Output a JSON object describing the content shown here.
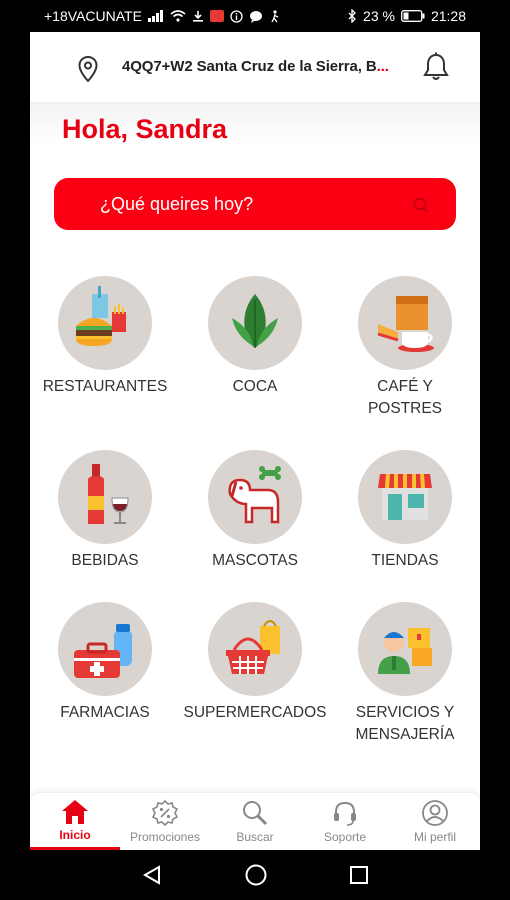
{
  "statusbar": {
    "carrier": "+18VACUNATE",
    "battery": "23 %",
    "time": "21:28"
  },
  "header": {
    "address": "4QQ7+W2 Santa Cruz de la Sierra, B",
    "address_ellipsis": "...",
    "pin_icon": "location-pin-icon",
    "bell_icon": "bell-icon"
  },
  "greeting": "Hola, Sandra",
  "search": {
    "placeholder": "¿Qué queires hoy?"
  },
  "colors": {
    "brand_red": "#e60012",
    "search_red": "#fb0012",
    "circle_bg": "#d9d4cf"
  },
  "categories": [
    {
      "label": "RESTAURANTES",
      "icon": "burger-fries-icon"
    },
    {
      "label": "COCA",
      "icon": "coca-leaves-icon"
    },
    {
      "label": "CAFÉ Y\nPOSTRES",
      "icon": "coffee-cake-icon"
    },
    {
      "label": "BEBIDAS",
      "icon": "bottle-wine-icon"
    },
    {
      "label": "MASCOTAS",
      "icon": "dog-bone-icon"
    },
    {
      "label": "TIENDAS",
      "icon": "storefront-icon"
    },
    {
      "label": "FARMACIAS",
      "icon": "first-aid-kit-icon"
    },
    {
      "label": "SUPERMERCADOS",
      "icon": "shopping-basket-icon"
    },
    {
      "label": "SERVICIOS Y\nMENSAJERÍA",
      "icon": "delivery-person-icon"
    }
  ],
  "bottom_nav": [
    {
      "label": "Inicio",
      "icon": "home-icon",
      "active": true
    },
    {
      "label": "Promociones",
      "icon": "percent-badge-icon",
      "active": false
    },
    {
      "label": "Buscar",
      "icon": "search-icon",
      "active": false
    },
    {
      "label": "Soporte",
      "icon": "headset-icon",
      "active": false
    },
    {
      "label": "Mi perfil",
      "icon": "user-icon",
      "active": false
    }
  ]
}
